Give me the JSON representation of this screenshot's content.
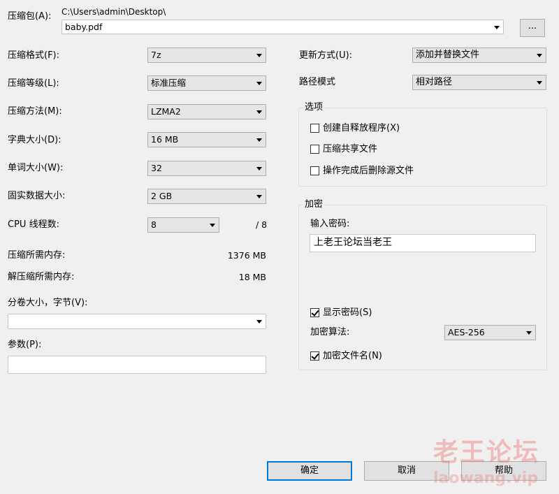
{
  "archive": {
    "label": "压缩包(A):",
    "path": "C:\\Users\\admin\\Desktop\\",
    "filename": "baby.pdf",
    "browse_label": "..."
  },
  "left": {
    "format": {
      "label": "压缩格式(F):",
      "value": "7z"
    },
    "level": {
      "label": "压缩等级(L):",
      "value": "标准压缩"
    },
    "method": {
      "label": "压缩方法(M):",
      "value": "LZMA2"
    },
    "dict": {
      "label": "字典大小(D):",
      "value": "16 MB"
    },
    "word": {
      "label": "单词大小(W):",
      "value": "32"
    },
    "solid": {
      "label": "固实数据大小:",
      "value": "2 GB"
    },
    "cpu": {
      "label": "CPU 线程数:",
      "value": "8",
      "max": "/ 8"
    },
    "mem_compress": {
      "label": "压缩所需内存:",
      "value": "1376 MB"
    },
    "mem_decompress": {
      "label": "解压缩所需内存:",
      "value": "18 MB"
    },
    "volume": {
      "label": "分卷大小，字节(V):",
      "value": ""
    },
    "params": {
      "label": "参数(P):",
      "value": ""
    }
  },
  "right": {
    "update": {
      "label": "更新方式(U):",
      "value": "添加并替换文件"
    },
    "pathmode": {
      "label": "路径模式",
      "value": "相对路径"
    },
    "options": {
      "title": "选项",
      "sfx": "创建自释放程序(X)",
      "shared": "压缩共享文件",
      "delete": "操作完成后删除源文件"
    },
    "encryption": {
      "title": "加密",
      "password_label": "输入密码:",
      "password_value": "上老王论坛当老王",
      "show_password": "显示密码(S)",
      "algo_label": "加密算法:",
      "algo_value": "AES-256",
      "encrypt_names": "加密文件名(N)"
    }
  },
  "buttons": {
    "ok": "确定",
    "cancel": "取消",
    "help": "帮助"
  },
  "watermark": {
    "text": "老王论坛",
    "url": "laowang.vip"
  }
}
